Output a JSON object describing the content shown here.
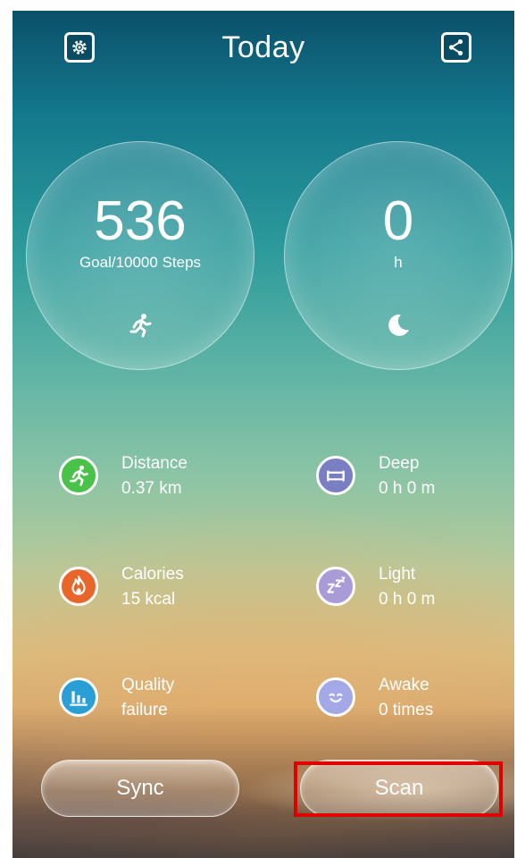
{
  "header": {
    "title": "Today",
    "left_icon": "settings-icon",
    "right_icon": "share-icon"
  },
  "steps_circle": {
    "value": "536",
    "label": "Goal/10000 Steps",
    "icon": "running-icon"
  },
  "sleep_circle": {
    "value": "0",
    "label": "h",
    "icon": "moon-icon"
  },
  "stats": {
    "distance": {
      "label": "Distance",
      "value": "0.37 km",
      "icon": "running-icon",
      "color": "#49c24a"
    },
    "calories": {
      "label": "Calories",
      "value": "15 kcal",
      "icon": "flame-icon",
      "color": "#e8662a"
    },
    "quality": {
      "label": "Quality",
      "value": "failure",
      "icon": "bar-chart-icon",
      "color": "#2a9fd6"
    },
    "deep": {
      "label": "Deep",
      "value": "0 h 0 m",
      "icon": "bed-icon",
      "color": "#7a7fc4"
    },
    "light": {
      "label": "Light",
      "value": "0 h 0 m",
      "icon": "zzz-icon",
      "color": "#a99ad8"
    },
    "awake": {
      "label": "Awake",
      "value": "0 times",
      "icon": "smiley-icon",
      "color": "#a4a8e6"
    }
  },
  "buttons": {
    "sync_label": "Sync",
    "scan_label": "Scan"
  },
  "highlight_color": "#e00000"
}
